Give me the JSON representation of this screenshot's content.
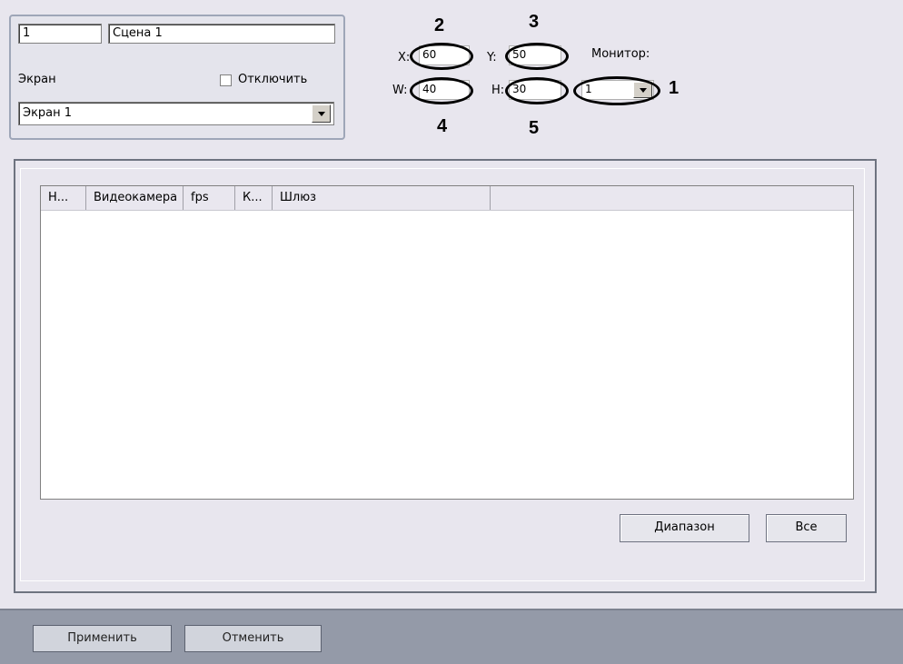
{
  "scene": {
    "number": "1",
    "name": "Сцена 1",
    "screen_label": "Экран",
    "disable_label": "Отключить",
    "screen_value": "Экран 1"
  },
  "position": {
    "x_label": "X:",
    "x_value": "60",
    "y_label": "Y:",
    "y_value": "50",
    "w_label": "W:",
    "w_value": "40",
    "h_label": "H:",
    "h_value": "30",
    "monitor_label": "Монитор:",
    "monitor_value": "1"
  },
  "callouts": [
    "1",
    "2",
    "3",
    "4",
    "5"
  ],
  "table": {
    "columns": [
      "Н...",
      "Видеокамера",
      "fps",
      "К...",
      "Шлюз"
    ]
  },
  "buttons": {
    "range": "Диапазон",
    "all": "Все",
    "apply": "Применить",
    "cancel": "Отменить"
  }
}
